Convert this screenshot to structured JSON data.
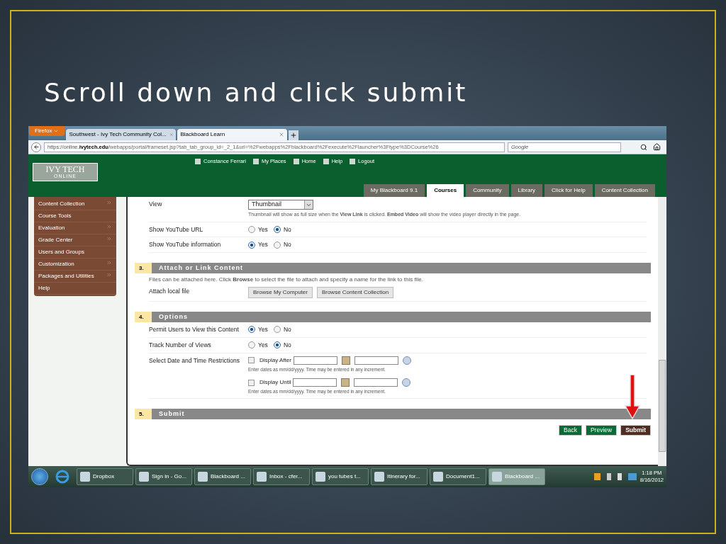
{
  "slide": {
    "title": "Scroll down and click submit"
  },
  "browser": {
    "menu_button": "Firefox",
    "tabs": [
      {
        "label": "Southwest - Ivy Tech Community Col...",
        "selected": false
      },
      {
        "label": "Blackboard Learn",
        "selected": true
      }
    ],
    "url_prefix": "https://online.",
    "url_host": "ivytech.edu",
    "url_rest": "/webapps/portal/frameset.jsp?tab_tab_group_id=_2_1&url=%2Fwebapps%2Fblackboard%2Fexecute%2Flauncher%3Ftype%3DCourse%26",
    "search_placeholder": "Google"
  },
  "header": {
    "logo_title": "IVY TECH",
    "logo_subtitle": "ONLINE",
    "user_links": [
      {
        "label": "Constance Ferrari"
      },
      {
        "label": "My Places"
      },
      {
        "label": "Home"
      },
      {
        "label": "Help"
      },
      {
        "label": "Logout"
      }
    ],
    "nav_tabs": [
      {
        "label": "My Blackboard 9.1",
        "selected": false
      },
      {
        "label": "Courses",
        "selected": true
      },
      {
        "label": "Community",
        "selected": false
      },
      {
        "label": "Library",
        "selected": false
      },
      {
        "label": "Click for Help",
        "selected": false
      },
      {
        "label": "Content Collection",
        "selected": false
      }
    ]
  },
  "sidebar": {
    "items": [
      {
        "label": "Content Collection",
        "has_submenu": true
      },
      {
        "label": "Course Tools",
        "has_submenu": false
      },
      {
        "label": "Evaluation",
        "has_submenu": true
      },
      {
        "label": "Grade Center",
        "has_submenu": true
      },
      {
        "label": "Users and Groups",
        "has_submenu": false
      },
      {
        "label": "Customization",
        "has_submenu": true
      },
      {
        "label": "Packages and Utilities",
        "has_submenu": true
      },
      {
        "label": "Help",
        "has_submenu": false
      }
    ]
  },
  "form_top": [
    {
      "kind": "select",
      "label": "View",
      "value": "Thumbnail",
      "hint": "Thumbnail will show as full size when the **View Link** is clicked. **Embed Video** will show the video player directly in the page."
    },
    {
      "kind": "radio",
      "label": "Show YouTube URL",
      "options": [
        {
          "label": "Yes",
          "selected": false
        },
        {
          "label": "No",
          "selected": true
        }
      ]
    },
    {
      "kind": "radio",
      "label": "Show YouTube information",
      "options": [
        {
          "label": "Yes",
          "selected": true
        },
        {
          "label": "No",
          "selected": false
        }
      ]
    }
  ],
  "sections": [
    {
      "number": "3.",
      "title": "Attach or Link Content",
      "intro": "Files can be attached here. Click **Browse** to select the file to attach and specify a name for the link to this file.",
      "rows": [
        {
          "kind": "buttons",
          "label": "Attach local file",
          "buttons": [
            "Browse My Computer",
            "Browse Content Collection"
          ]
        }
      ]
    },
    {
      "number": "4.",
      "title": "Options",
      "rows": [
        {
          "kind": "radio",
          "label": "Permit Users to View this Content",
          "options": [
            {
              "label": "Yes",
              "selected": true
            },
            {
              "label": "No",
              "selected": false
            }
          ]
        },
        {
          "kind": "radio",
          "label": "Track Number of Views",
          "options": [
            {
              "label": "Yes",
              "selected": false
            },
            {
              "label": "No",
              "selected": true
            }
          ]
        },
        {
          "kind": "dates",
          "label": "Select Date and Time Restrictions",
          "entries": [
            {
              "label": "Display After",
              "checked": false,
              "hint": "Enter dates as mm/dd/yyyy. Time may be entered in any increment."
            },
            {
              "label": "Display Until",
              "checked": false,
              "hint": "Enter dates as mm/dd/yyyy. Time may be entered in any increment."
            }
          ]
        }
      ]
    },
    {
      "number": "5.",
      "title": "Submit"
    }
  ],
  "actions": [
    {
      "label": "Back",
      "kind": "secondary"
    },
    {
      "label": "Preview",
      "kind": "secondary"
    },
    {
      "label": "Submit",
      "kind": "primary"
    }
  ],
  "taskbar": {
    "items": [
      {
        "label": "Dropbox",
        "selected": false
      },
      {
        "label": "Sign in - Go...",
        "selected": false
      },
      {
        "label": "Blackboard ...",
        "selected": false
      },
      {
        "label": "Inbox - cfer...",
        "selected": false
      },
      {
        "label": "you tubes t...",
        "selected": false
      },
      {
        "label": "Itinerary for...",
        "selected": false
      },
      {
        "label": "Document1...",
        "selected": false
      },
      {
        "label": "Blackboard ...",
        "selected": true
      }
    ],
    "time": "1:18 PM",
    "date": "8/16/2012"
  }
}
